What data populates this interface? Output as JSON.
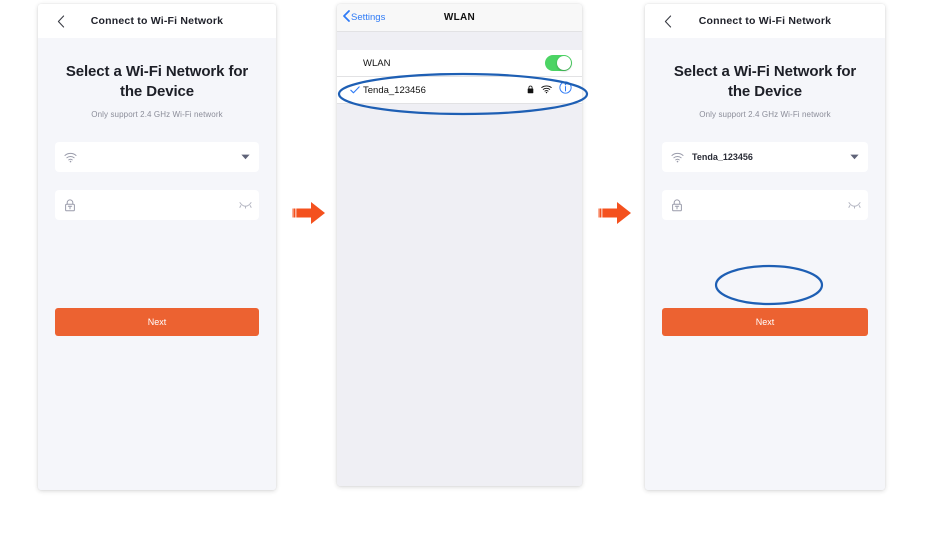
{
  "colors": {
    "accent_orange": "#ec6231",
    "annotation_blue": "#1e5fb4",
    "ios_blue": "#2f7bf6",
    "toggle_green": "#4cd464",
    "panel_bg": "#f5f6fa",
    "ios_body_bg": "#efeff4"
  },
  "panel_app_before": {
    "header": {
      "back_icon": "chevron-left-icon",
      "title": "Connect to Wi-Fi Network"
    },
    "headline": "Select a Wi-Fi Network for the Device",
    "subhead": "Only support 2.4 GHz Wi-Fi network",
    "ssid_field": {
      "icon": "wifi-icon",
      "value": "",
      "placeholder": "",
      "trailing_icon": "caret-down-icon"
    },
    "password_field": {
      "icon": "lock-icon",
      "value": "",
      "placeholder": "",
      "trailing_icon": "eye-closed-icon"
    },
    "next_label": "Next"
  },
  "panel_ios_settings": {
    "header": {
      "back_icon": "chevron-left-icon",
      "back_label": "Settings",
      "title": "WLAN"
    },
    "rows": [
      {
        "label": "WLAN",
        "type": "toggle",
        "toggle_on": true,
        "checked": false
      },
      {
        "label": "Tenda_123456",
        "type": "network",
        "checked": true,
        "icons": [
          "lock-icon",
          "wifi-icon",
          "info-circle-icon"
        ]
      }
    ]
  },
  "panel_app_after": {
    "header": {
      "back_icon": "chevron-left-icon",
      "title": "Connect to Wi-Fi Network"
    },
    "headline": "Select a Wi-Fi Network for the Device",
    "subhead": "Only support 2.4 GHz Wi-Fi network",
    "ssid_field": {
      "icon": "wifi-icon",
      "value": "Tenda_123456",
      "placeholder": "",
      "trailing_icon": "caret-down-icon"
    },
    "password_field": {
      "icon": "lock-icon",
      "value": "",
      "placeholder": "",
      "trailing_icon": "eye-closed-icon"
    },
    "next_label": "Next"
  },
  "flow": {
    "arrow_1": "arrow-right-icon",
    "arrow_2": "arrow-right-icon"
  },
  "annotations": [
    {
      "name": "highlight-wifi-row",
      "shape": "ellipse"
    },
    {
      "name": "highlight-next-button",
      "shape": "ellipse"
    }
  ]
}
